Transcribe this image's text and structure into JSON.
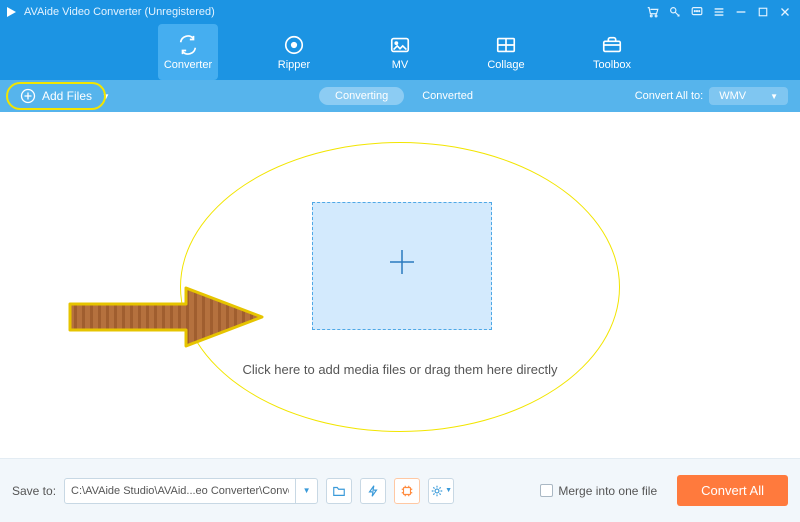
{
  "titlebar": {
    "title": "AVAide Video Converter (Unregistered)"
  },
  "nav": {
    "items": [
      {
        "label": "Converter"
      },
      {
        "label": "Ripper"
      },
      {
        "label": "MV"
      },
      {
        "label": "Collage"
      },
      {
        "label": "Toolbox"
      }
    ]
  },
  "subbar": {
    "add_files": "Add Files",
    "tab_converting": "Converting",
    "tab_converted": "Converted",
    "convert_all_to": "Convert All to:",
    "format": "WMV"
  },
  "canvas": {
    "hint": "Click here to add media files or drag them here directly"
  },
  "bottom": {
    "save_to": "Save to:",
    "path": "C:\\AVAide Studio\\AVAid...eo Converter\\Converted",
    "merge": "Merge into one file",
    "convert_all": "Convert All"
  },
  "icons": {
    "cart": "cart-icon",
    "key": "key-icon",
    "feedback": "feedback-icon",
    "menu": "menu-icon",
    "min": "minimize-icon",
    "max": "maximize-icon",
    "close": "close-icon"
  }
}
